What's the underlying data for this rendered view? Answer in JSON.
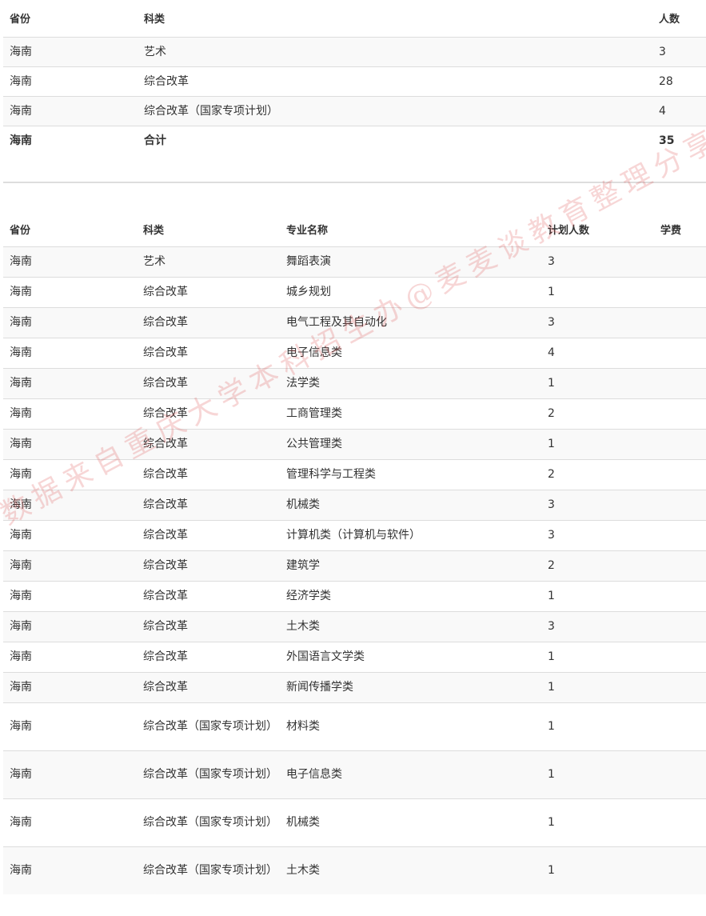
{
  "summary": {
    "headers": [
      "省份",
      "科类",
      "人数"
    ],
    "rows": [
      [
        "海南",
        "艺术",
        "3"
      ],
      [
        "海南",
        "综合改革",
        "28"
      ],
      [
        "海南",
        "综合改革（国家专项计划）",
        "4"
      ]
    ],
    "total": [
      "海南",
      "合计",
      "35"
    ]
  },
  "detail": {
    "headers": [
      "省份",
      "科类",
      "专业名称",
      "计划人数",
      "学费"
    ],
    "rows": [
      [
        "海南",
        "艺术",
        "舞蹈表演",
        "3",
        ""
      ],
      [
        "海南",
        "综合改革",
        "城乡规划",
        "1",
        ""
      ],
      [
        "海南",
        "综合改革",
        "电气工程及其自动化",
        "3",
        ""
      ],
      [
        "海南",
        "综合改革",
        "电子信息类",
        "4",
        ""
      ],
      [
        "海南",
        "综合改革",
        "法学类",
        "1",
        ""
      ],
      [
        "海南",
        "综合改革",
        "工商管理类",
        "2",
        ""
      ],
      [
        "海南",
        "综合改革",
        "公共管理类",
        "1",
        ""
      ],
      [
        "海南",
        "综合改革",
        "管理科学与工程类",
        "2",
        ""
      ],
      [
        "海南",
        "综合改革",
        "机械类",
        "3",
        ""
      ],
      [
        "海南",
        "综合改革",
        "计算机类（计算机与软件）",
        "3",
        ""
      ],
      [
        "海南",
        "综合改革",
        "建筑学",
        "2",
        ""
      ],
      [
        "海南",
        "综合改革",
        "经济学类",
        "1",
        ""
      ],
      [
        "海南",
        "综合改革",
        "土木类",
        "3",
        ""
      ],
      [
        "海南",
        "综合改革",
        "外国语言文学类",
        "1",
        ""
      ],
      [
        "海南",
        "综合改革",
        "新闻传播学类",
        "1",
        ""
      ],
      [
        "海南",
        "综合改革（国家专项计划）",
        "材料类",
        "1",
        ""
      ],
      [
        "海南",
        "综合改革（国家专项计划）",
        "电子信息类",
        "1",
        ""
      ],
      [
        "海南",
        "综合改革（国家专项计划）",
        "机械类",
        "1",
        ""
      ],
      [
        "海南",
        "综合改革（国家专项计划）",
        "土木类",
        "1",
        ""
      ]
    ]
  },
  "watermark": "数据来自重庆大学本科招生办@麦麦谈教育整理分享"
}
